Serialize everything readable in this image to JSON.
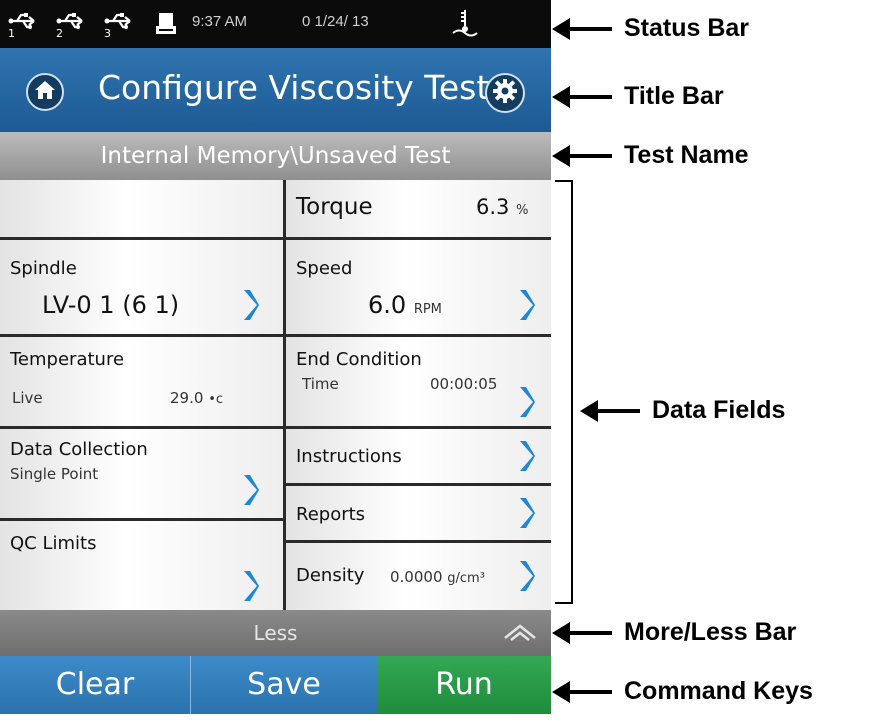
{
  "status_bar": {
    "usb_ports": [
      "1",
      "2",
      "3"
    ],
    "time": "9:37 AM",
    "date": "0 1/24/ 13",
    "icons": [
      "usb-icon",
      "printer-icon",
      "level-icon"
    ]
  },
  "title_bar": {
    "title": "Configure Viscosity Test",
    "icons": [
      "home-icon",
      "gear-icon"
    ]
  },
  "test_name": "Internal Memory\\Unsaved Test",
  "fields": {
    "torque": {
      "label": "Torque",
      "value": "6.3",
      "unit": "%"
    },
    "spindle": {
      "label": "Spindle",
      "value": "LV-0 1 (6 1)"
    },
    "speed": {
      "label": "Speed",
      "value": "6.0",
      "unit": "RPM"
    },
    "temperature": {
      "label": "Temperature",
      "mode": "Live",
      "value": "29.0",
      "unit": "•c"
    },
    "end_condition": {
      "label": "End Condition",
      "mode": "Time",
      "value": "00:00:05"
    },
    "data_collection": {
      "label": "Data Collection",
      "value": "Single Point"
    },
    "instructions": {
      "label": "Instructions"
    },
    "reports": {
      "label": "Reports"
    },
    "qc_limits": {
      "label": "QC Limits"
    },
    "density": {
      "label": "Density",
      "value": "0.0000",
      "unit": "g/cm³"
    }
  },
  "more_less": {
    "label": "Less"
  },
  "command_keys": {
    "clear": "Clear",
    "save": "Save",
    "run": "Run"
  },
  "colors": {
    "title_blue": "#2a6aa6",
    "run_green": "#2a9a46",
    "chevron_blue": "#1f86d6"
  },
  "annotations": {
    "status_bar": "Status Bar",
    "title_bar": "Title Bar",
    "test_name": "Test Name",
    "data_fields": "Data Fields",
    "more_less_bar": "More/Less Bar",
    "command_keys": "Command Keys"
  }
}
